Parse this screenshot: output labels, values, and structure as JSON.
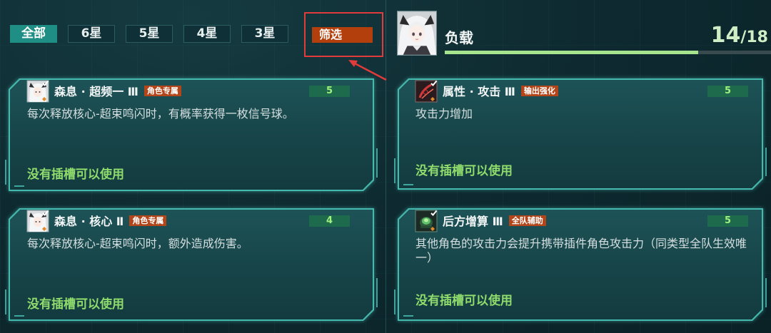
{
  "filters": {
    "tabs": [
      {
        "label": "全部",
        "selected": true
      },
      {
        "label": "6星",
        "selected": false
      },
      {
        "label": "5星",
        "selected": false
      },
      {
        "label": "4星",
        "selected": false
      },
      {
        "label": "3星",
        "selected": false
      }
    ],
    "filter_button": {
      "label": "筛选"
    }
  },
  "character": {
    "avatar_icon": "character-portrait-icon"
  },
  "load": {
    "label": "负载",
    "current": 14,
    "max": 18
  },
  "cards": [
    {
      "icon": "character-portrait-icon",
      "title": "森息 · 超频一 Ⅲ",
      "badge": "角色专属",
      "level": "5",
      "description": "每次释放核心-超束鸣闪时，有概率获得一枚信号球。",
      "footer": "没有插槽可以使用"
    },
    {
      "icon": "attack-attribute-icon",
      "title": "属性 · 攻击 Ⅲ",
      "badge": "输出强化",
      "level": "5",
      "description": "攻击力增加",
      "footer": "没有插槽可以使用"
    },
    {
      "icon": "character-portrait-icon",
      "title": "森息 · 核心 Ⅱ",
      "badge": "角色专属",
      "level": "4",
      "description": "每次释放核心-超束鸣闪时，额外造成伤害。",
      "footer": "没有插槽可以使用"
    },
    {
      "icon": "support-device-icon",
      "title": "后方增算 Ⅲ",
      "badge": "全队辅助",
      "level": "5",
      "description": "其他角色的攻击力会提升携带插件角色攻击力（同类型全队生效唯一）",
      "footer": "没有插槽可以使用"
    }
  ],
  "colors": {
    "accent": "#1f8e84",
    "filter_button": "#b3400c",
    "badge": "#b2461a",
    "footer_text": "#8fdc6c",
    "highlight": "#e23b3b",
    "load_fill": "#a6e48d"
  }
}
